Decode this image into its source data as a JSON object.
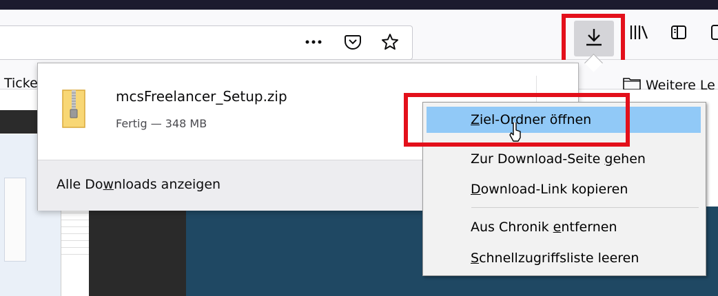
{
  "toolbar": {
    "page_actions_icon": "more-dots-icon",
    "pocket_icon": "pocket-icon",
    "bookmark_icon": "star-icon",
    "downloads_icon": "download-arrow-icon",
    "library_icon": "library-icon",
    "sidebar_icon": "sidebar-icon"
  },
  "bookmarks": {
    "left_partial": "Ticke",
    "folder_label": "Weitere Le"
  },
  "downloads_panel": {
    "item": {
      "filename": "mcsFreelancer_Setup.zip",
      "status": "Fertig — 348 MB"
    },
    "footer_pre": "Alle Do",
    "footer_accel": "w",
    "footer_post": "nloads anzeigen"
  },
  "context_menu": {
    "items": [
      {
        "pre": "",
        "accel": "Z",
        "post": "iel-Ordner öffnen"
      },
      {
        "pre": "Zur Download-Seite ",
        "accel": "g",
        "post": "ehen"
      },
      {
        "pre": "",
        "accel": "D",
        "post": "ownload-Link kopieren"
      },
      {
        "pre": "Aus Chronik ",
        "accel": "e",
        "post": "ntfernen"
      },
      {
        "pre": "",
        "accel": "S",
        "post": "chnellzugriffsliste leeren"
      }
    ]
  },
  "colors": {
    "annotation_red": "#e3101b",
    "menu_highlight": "#91c9f7"
  }
}
